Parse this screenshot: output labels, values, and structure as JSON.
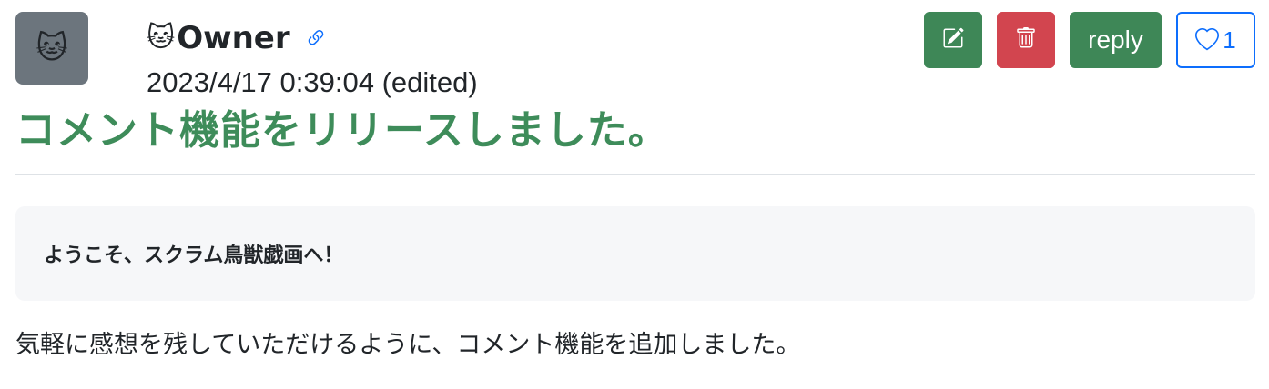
{
  "comment": {
    "avatar_emoji": "🐱",
    "author_emoji": "🐱",
    "author_name": "Owner",
    "timestamp": "2023/4/17 0:39:04 (edited)",
    "title": "コメント機能をリリースしました。",
    "quote": "ようこそ、スクラム鳥獣戯画へ！",
    "body": "気軽に感想を残していただけるように、コメント機能を追加しました。"
  },
  "actions": {
    "edit_icon": "edit-icon",
    "delete_icon": "trash-icon",
    "reply_label": "reply",
    "like_icon": "heart-icon",
    "like_count": "1"
  },
  "colors": {
    "title_green": "#3e8c5a",
    "edit_button": "#3e8757",
    "delete_button": "#d2454f",
    "reply_button": "#3e8757",
    "like_border": "#0d6efd",
    "avatar_bg": "#6c757d",
    "quote_bg": "#f6f7f9"
  }
}
